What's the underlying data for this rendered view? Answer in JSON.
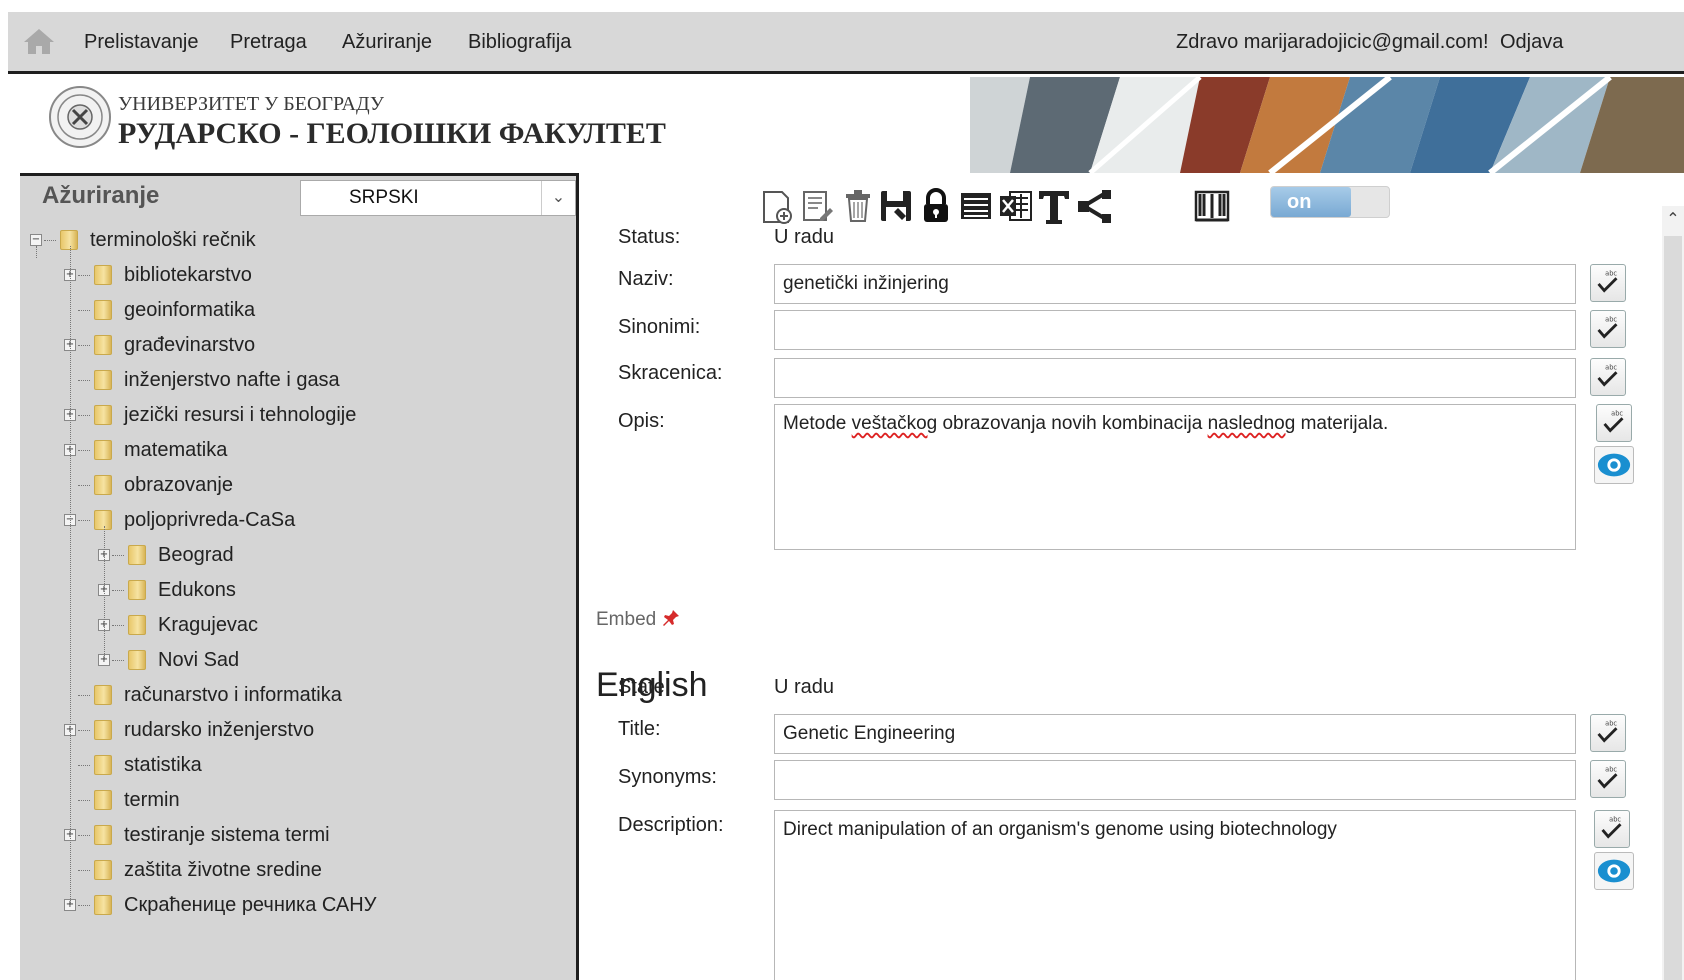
{
  "topbar": {
    "nav": [
      "Prelistavanje",
      "Pretraga",
      "Ažuriranje",
      "Bibliografija"
    ],
    "greeting": "Zdravo marijaradojicic@gmail.com!",
    "logout": "Odjava"
  },
  "banner": {
    "university": "УНИВЕРЗИТЕТ У БЕОГРАДУ",
    "faculty": "РУДАРСКО - ГЕОЛОШКИ ФАКУЛТЕТ"
  },
  "sidebar": {
    "title": "Ažuriranje",
    "language_selected": "SRPSKI",
    "tree": {
      "root": "terminološki rečnik",
      "children": [
        "bibliotekarstvo",
        "geoinformatika",
        "građevinarstvo",
        "inženjerstvo nafte i gasa",
        "jezički resursi i tehnologije",
        "matematika",
        "obrazovanje",
        "poljoprivreda-CaSa",
        "računarstvo i informatika",
        "rudarsko inženjerstvo",
        "statistika",
        "termin",
        "testiranje sistema termi",
        "zaštita životne sredine",
        "Скраћенице речника САНУ"
      ],
      "subchildren": [
        "Beograd",
        "Edukons",
        "Kragujevac",
        "Novi Sad"
      ]
    }
  },
  "toolbar": {
    "icons": [
      "new-document-icon",
      "edit-document-icon",
      "trash-icon",
      "save-icon",
      "lock-icon",
      "list-icon",
      "excel-icon",
      "text-icon",
      "share-icon",
      "book-icon"
    ],
    "toggle_label": "on"
  },
  "serbian": {
    "status_label": "Status:",
    "status_value": "U radu",
    "naziv_label": "Naziv:",
    "naziv_value": "genetički inžinjering",
    "sinonimi_label": "Sinonimi:",
    "sinonimi_value": "",
    "skracenica_label": "Skracenica:",
    "skracenica_value": "",
    "opis_label": "Opis:",
    "opis_before": "Metode ",
    "opis_word1": "veštačkog",
    "opis_mid": " obrazovanja novih kombinacija ",
    "opis_word2": "naslednog",
    "opis_after": " materijala."
  },
  "embed_label": "Embed",
  "english": {
    "heading": "English",
    "state_label": "State:",
    "state_value": "U radu",
    "title_label": "Title:",
    "title_value": "Genetic Engineering",
    "synonyms_label": "Synonyms:",
    "synonyms_value": "",
    "description_label": "Description:",
    "description_value": "Direct manipulation of an organism's genome using biotechnology"
  },
  "colors": {
    "menu_bg": "#d8d8d8",
    "sidebar_bg": "#d5d5d5",
    "toggle_on": "#79a9d3",
    "eye_icon": "#1a8fd0",
    "pin": "#d62b2b"
  }
}
